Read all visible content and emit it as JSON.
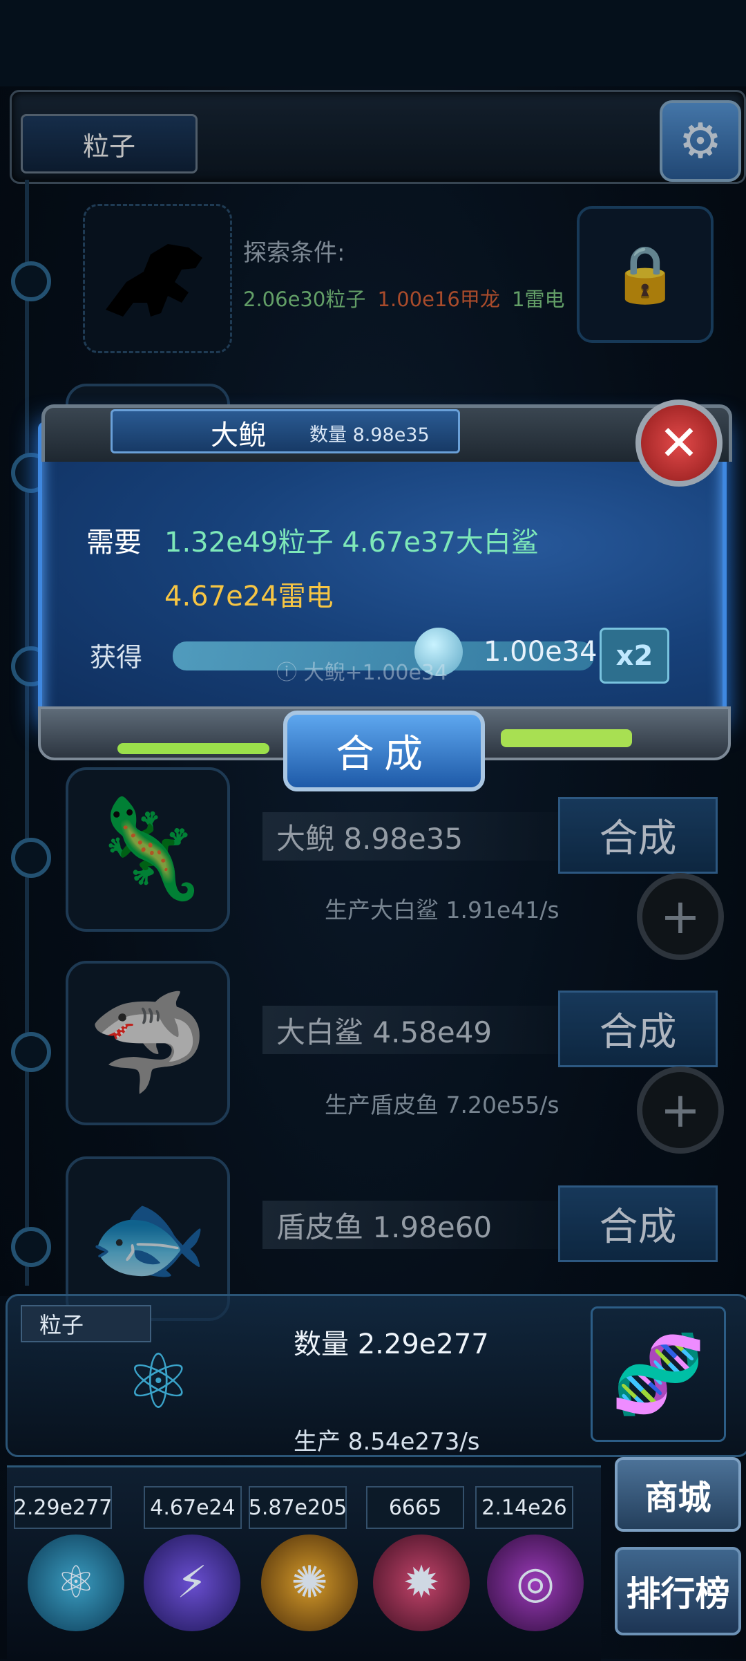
{
  "header": {
    "tab_label": "粒子"
  },
  "explore": {
    "title": "探索条件:",
    "req_particles": "2.06e30粒子",
    "req_dragon": "1.00e16甲龙",
    "req_thunder": "1雷电"
  },
  "cards": [
    {
      "name": "大鲵 8.98e35",
      "prod": "生产大白鲨 1.91e41/s",
      "button": "合成"
    },
    {
      "name": "大白鲨 4.58e49",
      "prod": "生产盾皮鱼 7.20e55/s",
      "button": "合成"
    },
    {
      "name": "盾皮鱼 1.98e60",
      "prod": "",
      "button": "合成"
    }
  ],
  "popup": {
    "name": "大鲵",
    "count": "数量 8.98e35",
    "need_label": "需要",
    "need_line1": "1.32e49粒子 4.67e37大白鲨",
    "need_line2": "4.67e24雷电",
    "gain_label": "获得",
    "gain_value": "1.00e34",
    "gain_note": "ⓘ 大鲵+1.00e34",
    "multiplier": "x2",
    "compose": "合成",
    "slider_fraction": 0.6
  },
  "particle_panel": {
    "tag": "粒子",
    "count": "数量 2.29e277",
    "production": "生产 8.54e273/s"
  },
  "currency": [
    {
      "value": "2.29e277",
      "icon": "particle-orb-icon",
      "color": "#3aa3c9"
    },
    {
      "value": "4.67e24",
      "icon": "thunder-orb-icon",
      "color": "#6a4fd1"
    },
    {
      "value": "5.87e205",
      "icon": "galaxy-orb-icon",
      "color": "#d49a2a"
    },
    {
      "value": "6665",
      "icon": "brain-orb-icon",
      "color": "#c2446a"
    },
    {
      "value": "2.14e26",
      "icon": "vortex-orb-icon",
      "color": "#9a3bb8"
    }
  ],
  "side_buttons": {
    "shop": "商城",
    "rank": "排行榜"
  }
}
